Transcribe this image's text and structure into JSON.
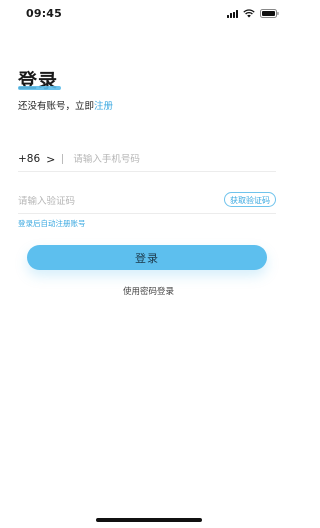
{
  "status_bar": {
    "time": "09:45",
    "icons": [
      "signal-icon",
      "wifi-icon",
      "battery-icon"
    ]
  },
  "login": {
    "title": "登录",
    "register_prompt": "还没有账号，立即",
    "register_link": "注册",
    "country_code": "+86",
    "country_selector_arrow": ">",
    "phone_placeholder": "请输入手机号码",
    "phone_value": "",
    "code_placeholder": "请输入验证码",
    "code_value": "",
    "get_code_label": "获取验证码",
    "auto_register_hint": "登录后自动注册账号",
    "login_button": "登录",
    "password_login_link": "使用密码登录"
  },
  "colors": {
    "accent": "#5dbfee",
    "link": "#3aa8e0"
  }
}
